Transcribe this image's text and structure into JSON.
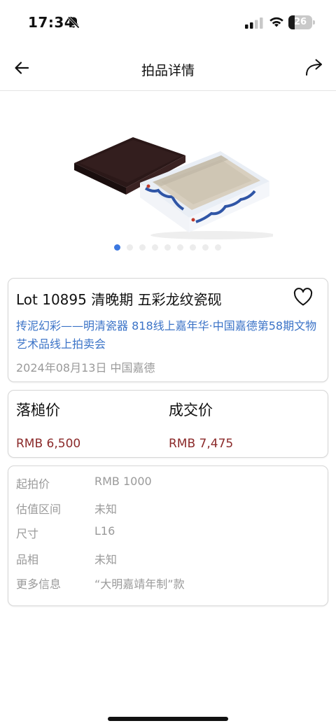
{
  "status_bar": {
    "time": "17:34",
    "battery_level": 26,
    "battery_label": "26",
    "icons": [
      "bell-muted-icon",
      "signal-icon",
      "wifi-icon",
      "battery-icon"
    ]
  },
  "nav": {
    "title": "拍品详情",
    "back_icon": "back-arrow-icon",
    "share_icon": "share-arrow-icon"
  },
  "carousel": {
    "image_subject": "ink stone box",
    "slide_count": 9,
    "active_index": 0
  },
  "lot": {
    "title": "Lot 10895 清晚期  五彩龙纹瓷砚",
    "sale_name": "抟泥幻彩——明清瓷器 818线上嘉年华·中国嘉德第58期文物艺术品线上拍卖会",
    "date_house": "2024年08月13日 中国嘉德",
    "favorite_icon": "heart-icon"
  },
  "prices": {
    "hammer_label": "落槌价",
    "hammer_value": "RMB 6,500",
    "deal_label": "成交价",
    "deal_value": "RMB 7,475"
  },
  "details": [
    {
      "key": "起拍价",
      "value": "RMB 1000"
    },
    {
      "key": "估值区间",
      "value": "未知"
    },
    {
      "key": "尺寸",
      "value": "L16"
    },
    {
      "key": "品相",
      "value": "未知"
    },
    {
      "key": "更多信息",
      "value": "“大明嘉靖年制”款"
    }
  ],
  "colors": {
    "link": "#3b73c7",
    "price": "#8b2a2a",
    "active_dot": "#3c78e0",
    "muted_text": "#9a9a9a"
  }
}
